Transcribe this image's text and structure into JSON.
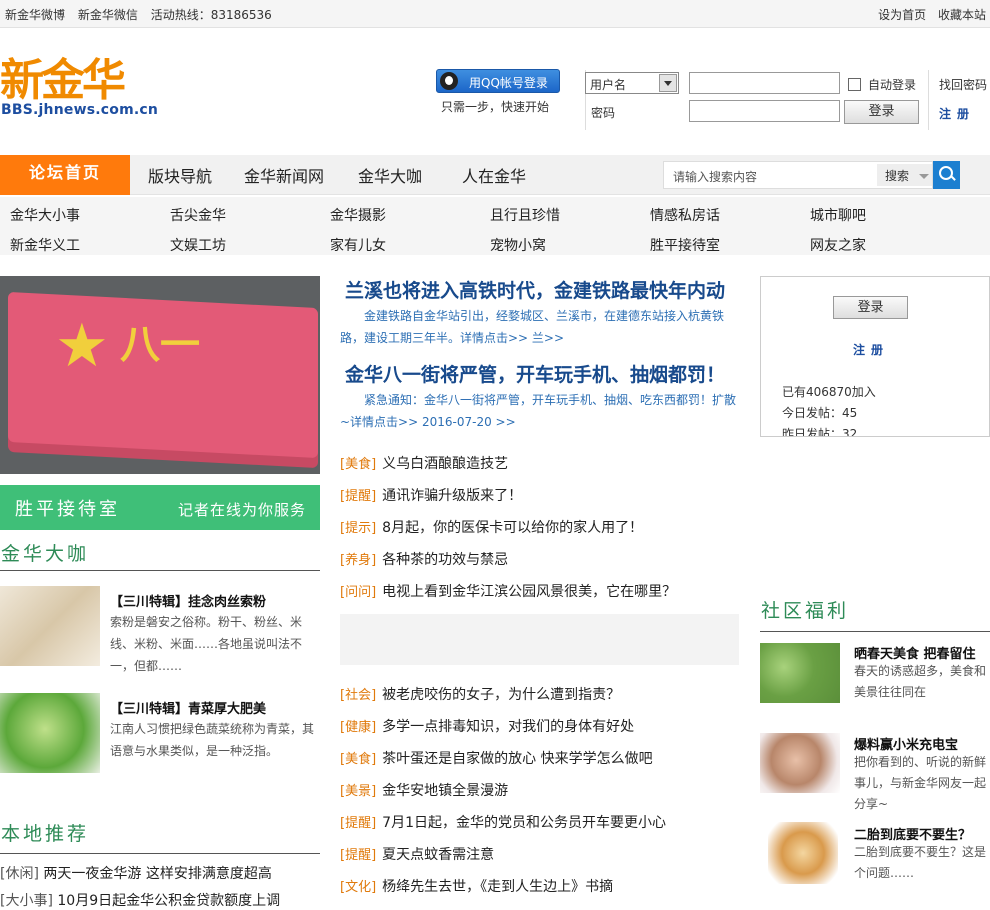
{
  "topbar": {
    "links": [
      "新金华微博",
      "新金华微信",
      "活动热线：83186536"
    ],
    "right": [
      "设为首页",
      "收藏本站"
    ]
  },
  "logo": {
    "cn": "新金华",
    "url": "BBS.jhnews.com.cn"
  },
  "login": {
    "qq_button": "用QQ帐号登录",
    "qq_sub": "只需一步，快速开始",
    "user_select": "用户名",
    "password_label": "密码",
    "auto_login": "自动登录",
    "login_button": "登录",
    "find_password": "找回密码",
    "register": "注册"
  },
  "nav": {
    "home": "论坛首页",
    "items": [
      "版块导航",
      "金华新闻网",
      "金华大咖",
      "人在金华"
    ],
    "search_placeholder": "请输入搜索内容",
    "search_option": "搜索"
  },
  "subnav": {
    "row1": [
      "金华大小事",
      "舌尖金华",
      "金华摄影",
      "且行且珍惜",
      "情感私房话",
      "城市聊吧"
    ],
    "row2": [
      "新金华义工",
      "文娱工坊",
      "家有儿女",
      "宠物小窝",
      "胜平接待室",
      "网友之家"
    ]
  },
  "hero": {
    "image_text": "八一"
  },
  "banner": {
    "main": "胜平接待室",
    "sub": "记者在线为你服务"
  },
  "jinhua_dk": {
    "title": "金华大咖",
    "items": [
      {
        "title": "【三川特辑】挂念肉丝索粉",
        "text": "索粉是磐安之俗称。粉干、粉丝、米线、米粉、米面……各地虽说叫法不一，但都……"
      },
      {
        "title": "【三川特辑】青菜厚大肥美",
        "text": "江南人习惯把绿色蔬菜统称为青菜，其语意与水果类似，是一种泛指。"
      }
    ]
  },
  "local": {
    "title": "本地推荐",
    "items": [
      {
        "tag": "[休闲]",
        "text": "两天一夜金华游 这样安排满意度超高"
      },
      {
        "tag": "[大小事]",
        "text": "10月9日起金华公积金贷款额度上调"
      }
    ]
  },
  "headlines": [
    {
      "title": "兰溪也将进入高铁时代，金建铁路最快年内动",
      "desc": "金建铁路自金华站引出，经婺城区、兰溪市，在建德东站接入杭黄铁路，建设工期三年半。详情点击>> 兰>>"
    },
    {
      "title": "金华八一街将严管，开车玩手机、抽烟都罚！",
      "desc": "紧急通知：金华八一街将严管，开车玩手机、抽烟、吃东西都罚！扩散~详情点击>> 2016-07-20 >>"
    }
  ],
  "news1": [
    {
      "tag": "[美食]",
      "text": "义乌白酒酿酿造技艺"
    },
    {
      "tag": "[提醒]",
      "text": "通讯诈骗升级版来了！"
    },
    {
      "tag": "[提示]",
      "text": "8月起，你的医保卡可以给你的家人用了！"
    },
    {
      "tag": "[养身]",
      "text": "各种茶的功效与禁忌"
    },
    {
      "tag": "[问问]",
      "text": "电视上看到金华江滨公园风景很美，它在哪里？"
    }
  ],
  "news2": [
    {
      "tag": "[社会]",
      "text": "被老虎咬伤的女子，为什么遭到指责？"
    },
    {
      "tag": "[健康]",
      "text": "多学一点排毒知识，对我们的身体有好处"
    },
    {
      "tag": "[美食]",
      "text": "茶叶蛋还是自家做的放心 快来学学怎么做吧"
    },
    {
      "tag": "[美景]",
      "text": "金华安地镇全景漫游"
    },
    {
      "tag": "[提醒]",
      "text": "7月1日起，金华的党员和公务员开车要更小心"
    },
    {
      "tag": "[提醒]",
      "text": "夏天点蚊香需注意"
    },
    {
      "tag": "[文化]",
      "text": "杨绛先生去世，《走到人生边上》书摘"
    }
  ],
  "side_login": {
    "button": "登录",
    "register": "注册",
    "stats": [
      "已有406870加入",
      "今日发帖：45",
      "昨日发帖：32"
    ]
  },
  "welfare": {
    "title": "社区福利",
    "items": [
      {
        "title": "晒春天美食 把春留住",
        "text": "春天的诱惑超多，美食和美景往往同在"
      },
      {
        "title": "爆料赢小米充电宝",
        "text": "把你看到的、听说的新鲜事儿，与新金华网友一起分享~"
      },
      {
        "title": "二胎到底要不要生？",
        "text": "二胎到底要不要生？这是个问题……"
      }
    ]
  }
}
